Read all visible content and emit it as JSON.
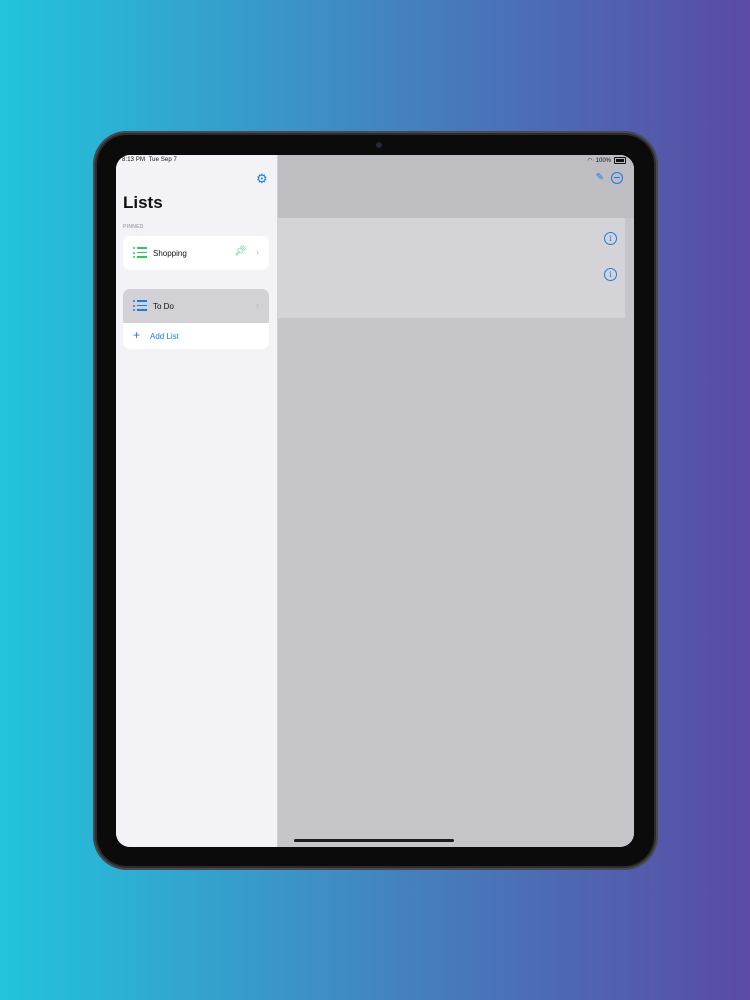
{
  "status_bar": {
    "time": "8:13 PM",
    "date": "Tue Sep 7",
    "battery": "100%"
  },
  "sidebar": {
    "title": "Lists",
    "section_label": "PINNED",
    "lists": [
      {
        "label": "Shopping",
        "pinned": true,
        "icon": "list-icon",
        "icon_color": "#34c759"
      },
      {
        "label": "To Do",
        "pinned": false,
        "selected": true,
        "icon": "list-icon",
        "icon_color": "#1a7ae8"
      }
    ],
    "add_list_label": "Add List"
  },
  "main": {
    "info_buttons": 2
  },
  "colors": {
    "accent": "#1a7ae8",
    "pin": "#34c759"
  }
}
